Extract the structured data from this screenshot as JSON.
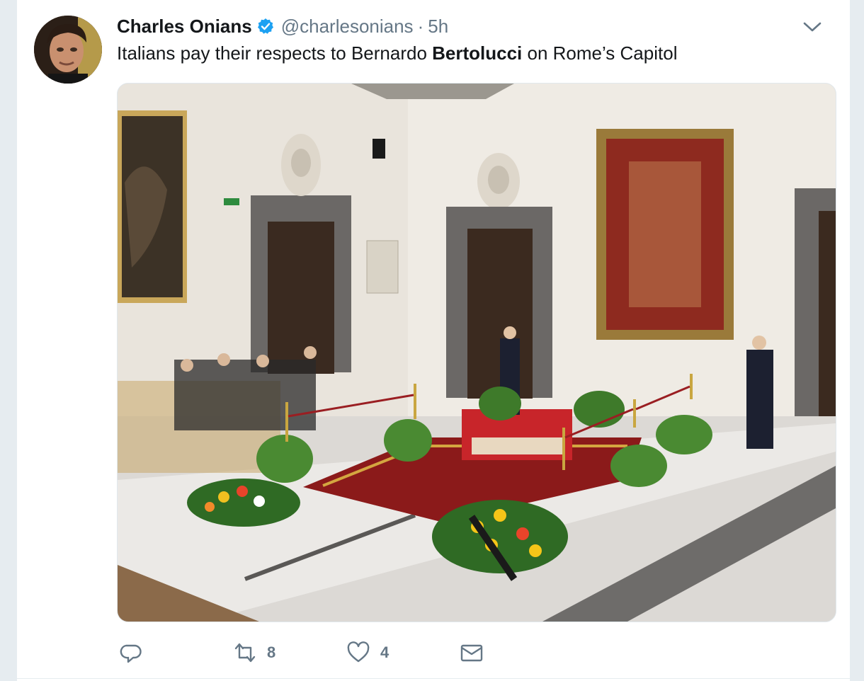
{
  "tweet": {
    "author_name": "Charles Onians",
    "author_handle": "@charlesonians",
    "separator": "·",
    "time": "5h",
    "text_before": "Italians pay their respects to Bernardo ",
    "text_bold": "Bertolucci",
    "text_after": " on Rome’s Capitol"
  },
  "actions": {
    "reply_icon": "reply-icon",
    "retweet_icon": "retweet-icon",
    "retweet_count": "8",
    "like_icon": "heart-icon",
    "like_count": "4",
    "dm_icon": "envelope-icon"
  },
  "colors": {
    "verified": "#1da1f2",
    "secondary_text": "#657786",
    "primary_text": "#14171a"
  }
}
